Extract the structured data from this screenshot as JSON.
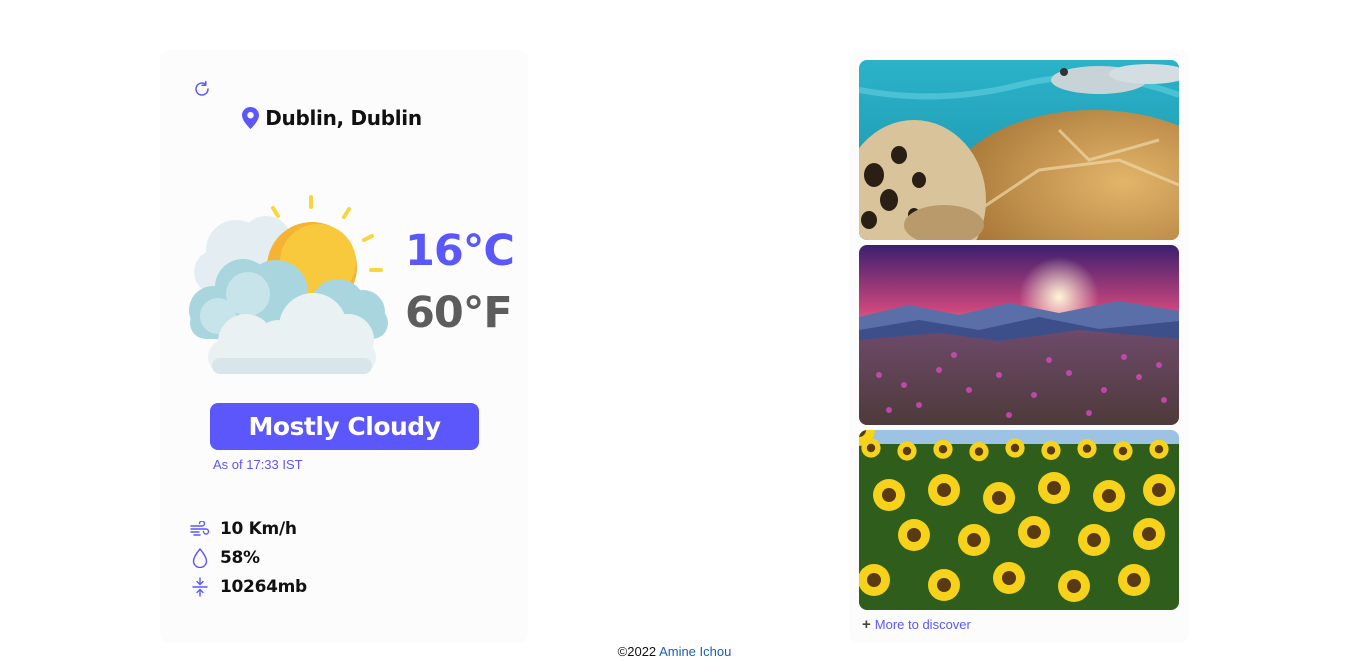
{
  "weather": {
    "location": "Dublin, Dublin",
    "temp_c": "16°C",
    "temp_f": "60°F",
    "condition": "Mostly Cloudy",
    "as_of": "As of 17:33 IST",
    "wind": "10 Km/h",
    "humidity": "58%",
    "pressure": "10264mb"
  },
  "gallery": {
    "more_label": "More to discover",
    "images": [
      "sea-turtle-photo",
      "mountain-sunset-photo",
      "sunflower-field-photo"
    ]
  },
  "footer": {
    "copyright": "©2022",
    "author": "Amine Ichou"
  },
  "colors": {
    "accent": "#5b57fb",
    "muted_temp": "#5d5d5d",
    "card_bg": "#fcfcfc"
  }
}
